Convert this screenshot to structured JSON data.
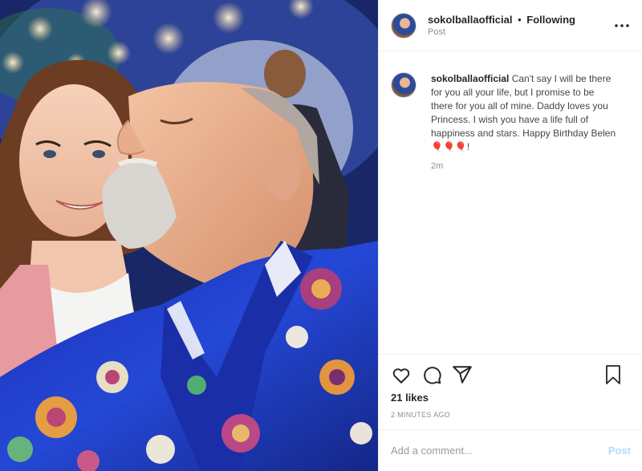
{
  "post": {
    "author": "sokolballaofficial",
    "following": "Following",
    "separator": "•",
    "subline": "Post",
    "caption": "Can't say I will be there for you all your life, but I promise to be there for you all of mine. Daddy loves you Princess. I wish you have a life full of happiness and stars. Happy Birthday Belen 🎈🎈🎈!",
    "caption_time": "2m",
    "likes": "21 likes",
    "timestamp": "2 minutes ago"
  },
  "comment": {
    "placeholder": "Add a comment...",
    "post_label": "Post"
  },
  "icons": {
    "more": "more-options-icon",
    "like": "heart-icon",
    "comment": "comment-icon",
    "share": "share-icon",
    "save": "bookmark-icon"
  },
  "colors": {
    "border": "#efefef",
    "text": "#262626",
    "muted": "#8e8e8e",
    "post_disabled": "#b3dbff"
  }
}
